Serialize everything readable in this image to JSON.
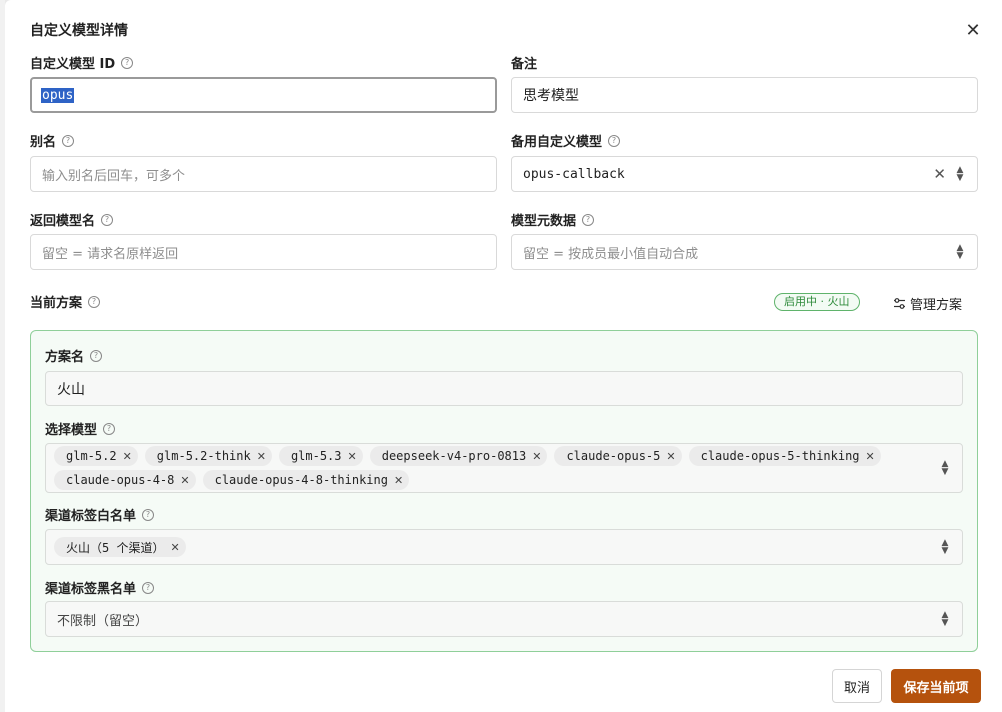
{
  "dialog": {
    "title": "自定义模型详情",
    "close_icon": "✕"
  },
  "fields": {
    "model_id": {
      "label": "自定义模型 ID",
      "value": "opus"
    },
    "note": {
      "label": "备注",
      "value": "思考模型"
    },
    "alias": {
      "label": "别名",
      "placeholder": "输入别名后回车，可多个"
    },
    "fallback": {
      "label": "备用自定义模型",
      "value": "opus-callback"
    },
    "return_name": {
      "label": "返回模型名",
      "placeholder": "留空 = 请求名原样返回"
    },
    "metadata": {
      "label": "模型元数据",
      "placeholder": "留空 = 按成员最小值自动合成"
    }
  },
  "plan": {
    "section_label": "当前方案",
    "status_badge": "启用中 · 火山",
    "manage_label": "管理方案",
    "name_label": "方案名",
    "name_value": "火山",
    "models_label": "选择模型",
    "models": [
      "glm-5.2",
      "glm-5.2-think",
      "glm-5.3",
      "deepseek-v4-pro-0813",
      "claude-opus-5",
      "claude-opus-5-thinking",
      "claude-opus-4-8",
      "claude-opus-4-8-thinking"
    ],
    "whitelist_label": "渠道标签白名单",
    "whitelist": [
      "火山（5 个渠道）"
    ],
    "blacklist_label": "渠道标签黑名单",
    "blacklist_value": "不限制（留空）"
  },
  "footer": {
    "cancel": "取消",
    "save": "保存当前项"
  },
  "colors": {
    "accent": "#b5520d",
    "plan_border": "#8fcf99",
    "badge_text": "#2e8a3a",
    "selection": "#2e63c6"
  },
  "icons": {
    "help": "question-circle-icon",
    "clear": "clear-x-icon",
    "select": "chevron-up-down-icon",
    "manage": "sliders-icon",
    "chip_remove": "remove-x-icon"
  }
}
